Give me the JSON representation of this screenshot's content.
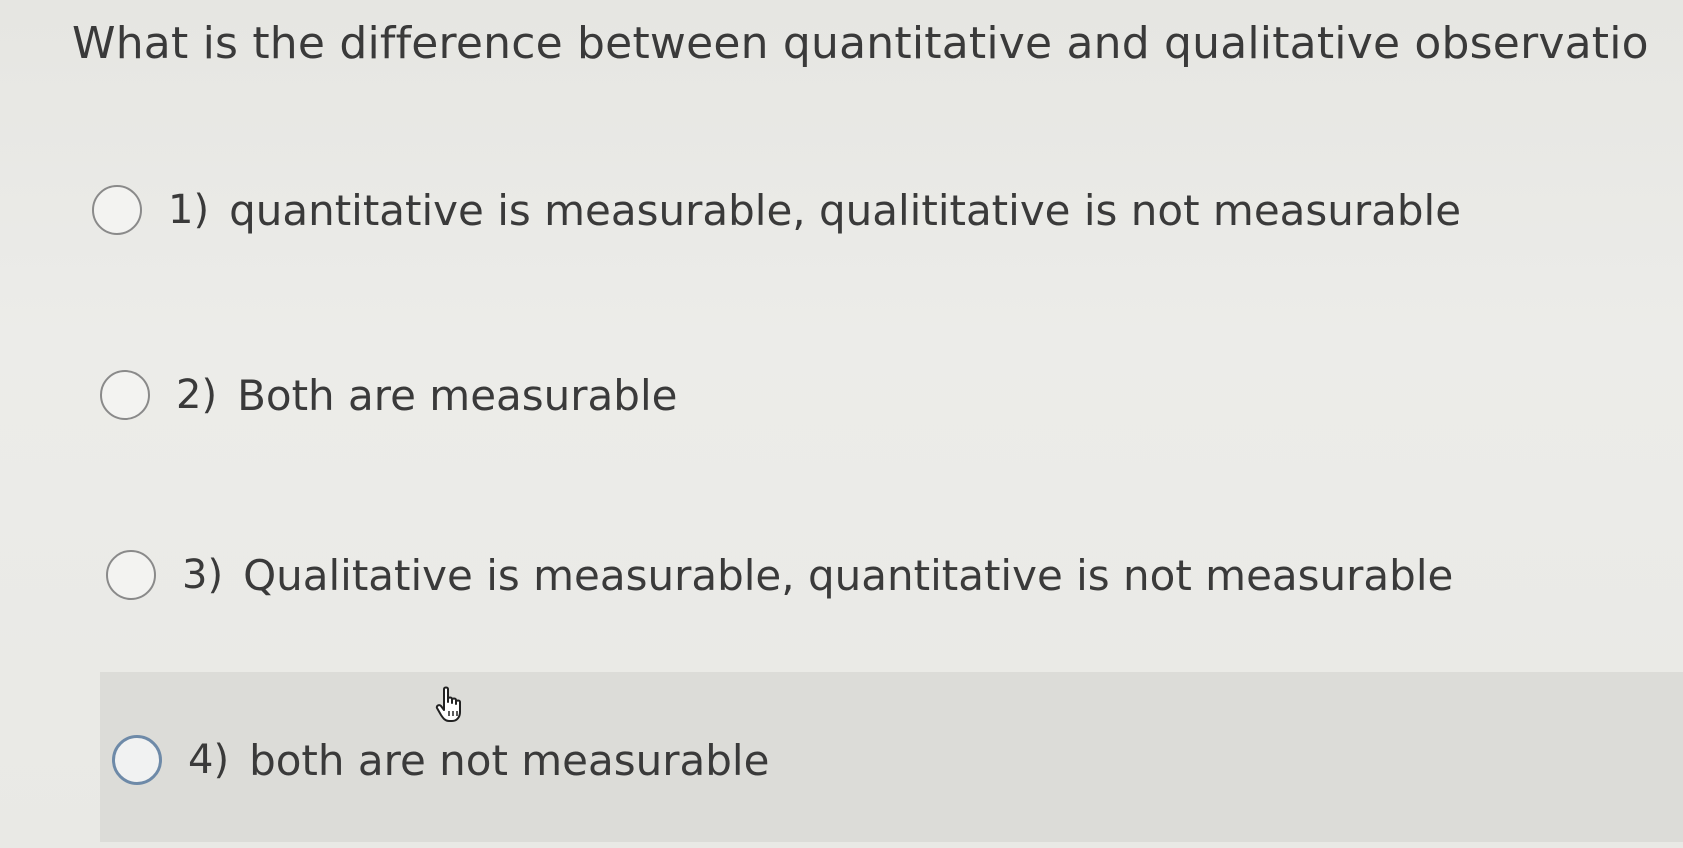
{
  "question": {
    "text": "What is the difference between quantitative and qualitative observatio"
  },
  "options": [
    {
      "number": "1)",
      "label": "quantitative is measurable, qualititative is not measurable"
    },
    {
      "number": "2)",
      "label": "Both are measurable"
    },
    {
      "number": "3)",
      "label": "Qualitative is measurable, quantitative is not measurable"
    },
    {
      "number": "4)",
      "label": "both are not measurable"
    }
  ],
  "colors": {
    "background": "#e9e9e6",
    "hover_row": "#dcdcd8",
    "radio_focus": "#6e8aa8"
  },
  "icons": {
    "cursor": "hand-pointer-icon"
  }
}
